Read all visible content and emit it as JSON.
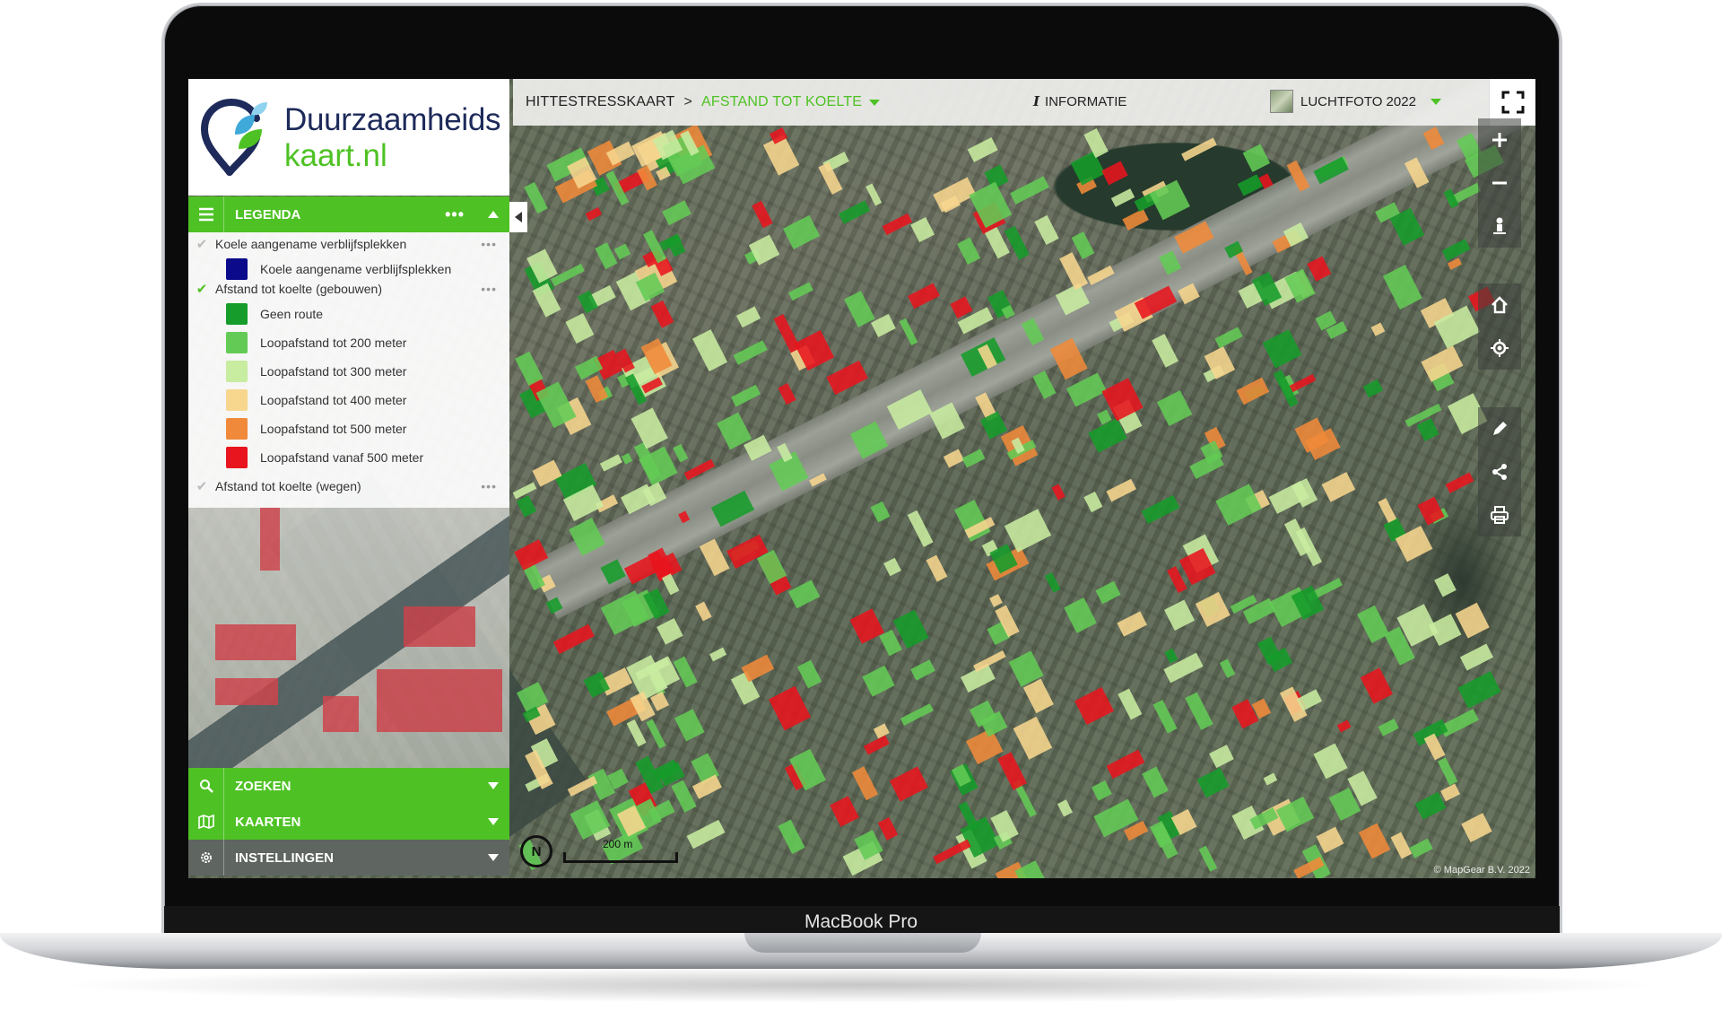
{
  "device": {
    "label": "MacBook Pro"
  },
  "logo": {
    "line1": "Duurzaamheids",
    "line2": "kaart.nl"
  },
  "topbar": {
    "breadcrumb_root": "HITTESTRESSKAART",
    "breadcrumb_separator": ">",
    "breadcrumb_active": "AFSTAND TOT KOELTE",
    "info_label": "INFORMATIE",
    "basemap_label": "LUCHTFOTO 2022"
  },
  "legend": {
    "header": "LEGENDA",
    "layers": [
      {
        "label": "Koele aangename verblijfsplekken",
        "checked": false
      },
      {
        "label": "Afstand tot koelte (gebouwen)",
        "checked": true
      },
      {
        "label": "Afstand tot koelte (wegen)",
        "checked": false
      }
    ],
    "items": [
      {
        "label": "Koele aangename verblijfsplekken",
        "color": "#0a0a8a"
      },
      {
        "label": "Geen route",
        "color": "#169c2a"
      },
      {
        "label": "Loopafstand tot 200 meter",
        "color": "#63cb55"
      },
      {
        "label": "Loopafstand tot 300 meter",
        "color": "#c8eca0"
      },
      {
        "label": "Loopafstand tot 400 meter",
        "color": "#f7d68e"
      },
      {
        "label": "Loopafstand tot 500 meter",
        "color": "#f08a3a"
      },
      {
        "label": "Loopafstand vanaf 500 meter",
        "color": "#e8141e"
      }
    ]
  },
  "panels": {
    "search": "ZOEKEN",
    "maps": "KAARTEN",
    "settings": "INSTELLINGEN"
  },
  "map": {
    "north_label": "N",
    "scale_label": "200 m",
    "attribution": "© MapGear B.V. 2022",
    "controls": [
      "zoom-in-icon",
      "zoom-out-icon",
      "pegman-icon",
      "home-icon",
      "locate-icon",
      "pencil-icon",
      "share-icon",
      "print-icon"
    ]
  },
  "colors": {
    "accent": "#4ec224",
    "logo_navy": "#1d2a5a",
    "settings_bar": "#5f6560"
  }
}
